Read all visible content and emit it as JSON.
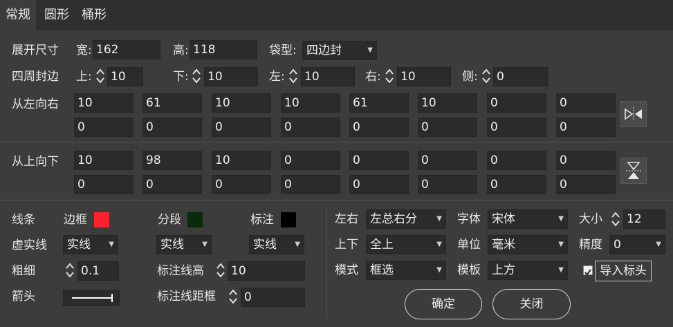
{
  "tabs": [
    {
      "label": "常规",
      "active": true
    },
    {
      "label": "圆形",
      "active": false
    },
    {
      "label": "桶形",
      "active": false
    }
  ],
  "size": {
    "label": "展开尺寸",
    "width_label": "宽:",
    "width_value": "162",
    "height_label": "高:",
    "height_value": "118",
    "bag_label": "袋型:",
    "bag_value": "四边封"
  },
  "seal": {
    "label": "四周封边",
    "top_label": "上:",
    "top_value": "10",
    "bottom_label": "下:",
    "bottom_value": "10",
    "left_label": "左:",
    "left_value": "10",
    "right_label": "右:",
    "right_value": "10",
    "side_label": "侧:",
    "side_value": "0"
  },
  "lr": {
    "label": "从左向右",
    "row1": [
      "10",
      "61",
      "10",
      "10",
      "61",
      "10",
      "0",
      "0"
    ],
    "row2": [
      "0",
      "0",
      "0",
      "0",
      "0",
      "0",
      "0",
      "0"
    ]
  },
  "tb": {
    "label": "从上向下",
    "row1": [
      "10",
      "98",
      "10",
      "0",
      "0",
      "0",
      "0",
      "0"
    ],
    "row2": [
      "0",
      "0",
      "0",
      "0",
      "0",
      "0",
      "0",
      "0"
    ]
  },
  "lines": {
    "line_label": "线条",
    "border_label": "边框",
    "border_color": "#ff2030",
    "segment_label": "分段",
    "segment_color": "#0a2a0a",
    "mark_label": "标注",
    "mark_color": "#000000",
    "dash_label": "虚实线",
    "dash1": "实线",
    "dash2": "实线",
    "dash3": "实线",
    "thick_label": "粗细",
    "thick_value": "0.1",
    "markh_label": "标注线高",
    "markh_value": "10",
    "arrow_label": "箭头",
    "markd_label": "标注线距框",
    "markd_value": "0"
  },
  "right": {
    "lr_label": "左右",
    "lr_value": "左总右分",
    "font_label": "字体",
    "font_value": "宋体",
    "size_label": "大小",
    "size_value": "12",
    "ud_label": "上下",
    "ud_value": "全上",
    "unit_label": "单位",
    "unit_value": "毫米",
    "prec_label": "精度",
    "prec_value": "0",
    "mode_label": "模式",
    "mode_value": "框选",
    "tpl_label": "模板",
    "tpl_value": "上方",
    "import_label": "导入标头",
    "import_checked": true
  },
  "buttons": {
    "ok": "确定",
    "close": "关闭"
  },
  "colors": {
    "bg": "#3c3c3c",
    "tabbar": "#2f2f2f",
    "field": "#2b2b2b"
  }
}
